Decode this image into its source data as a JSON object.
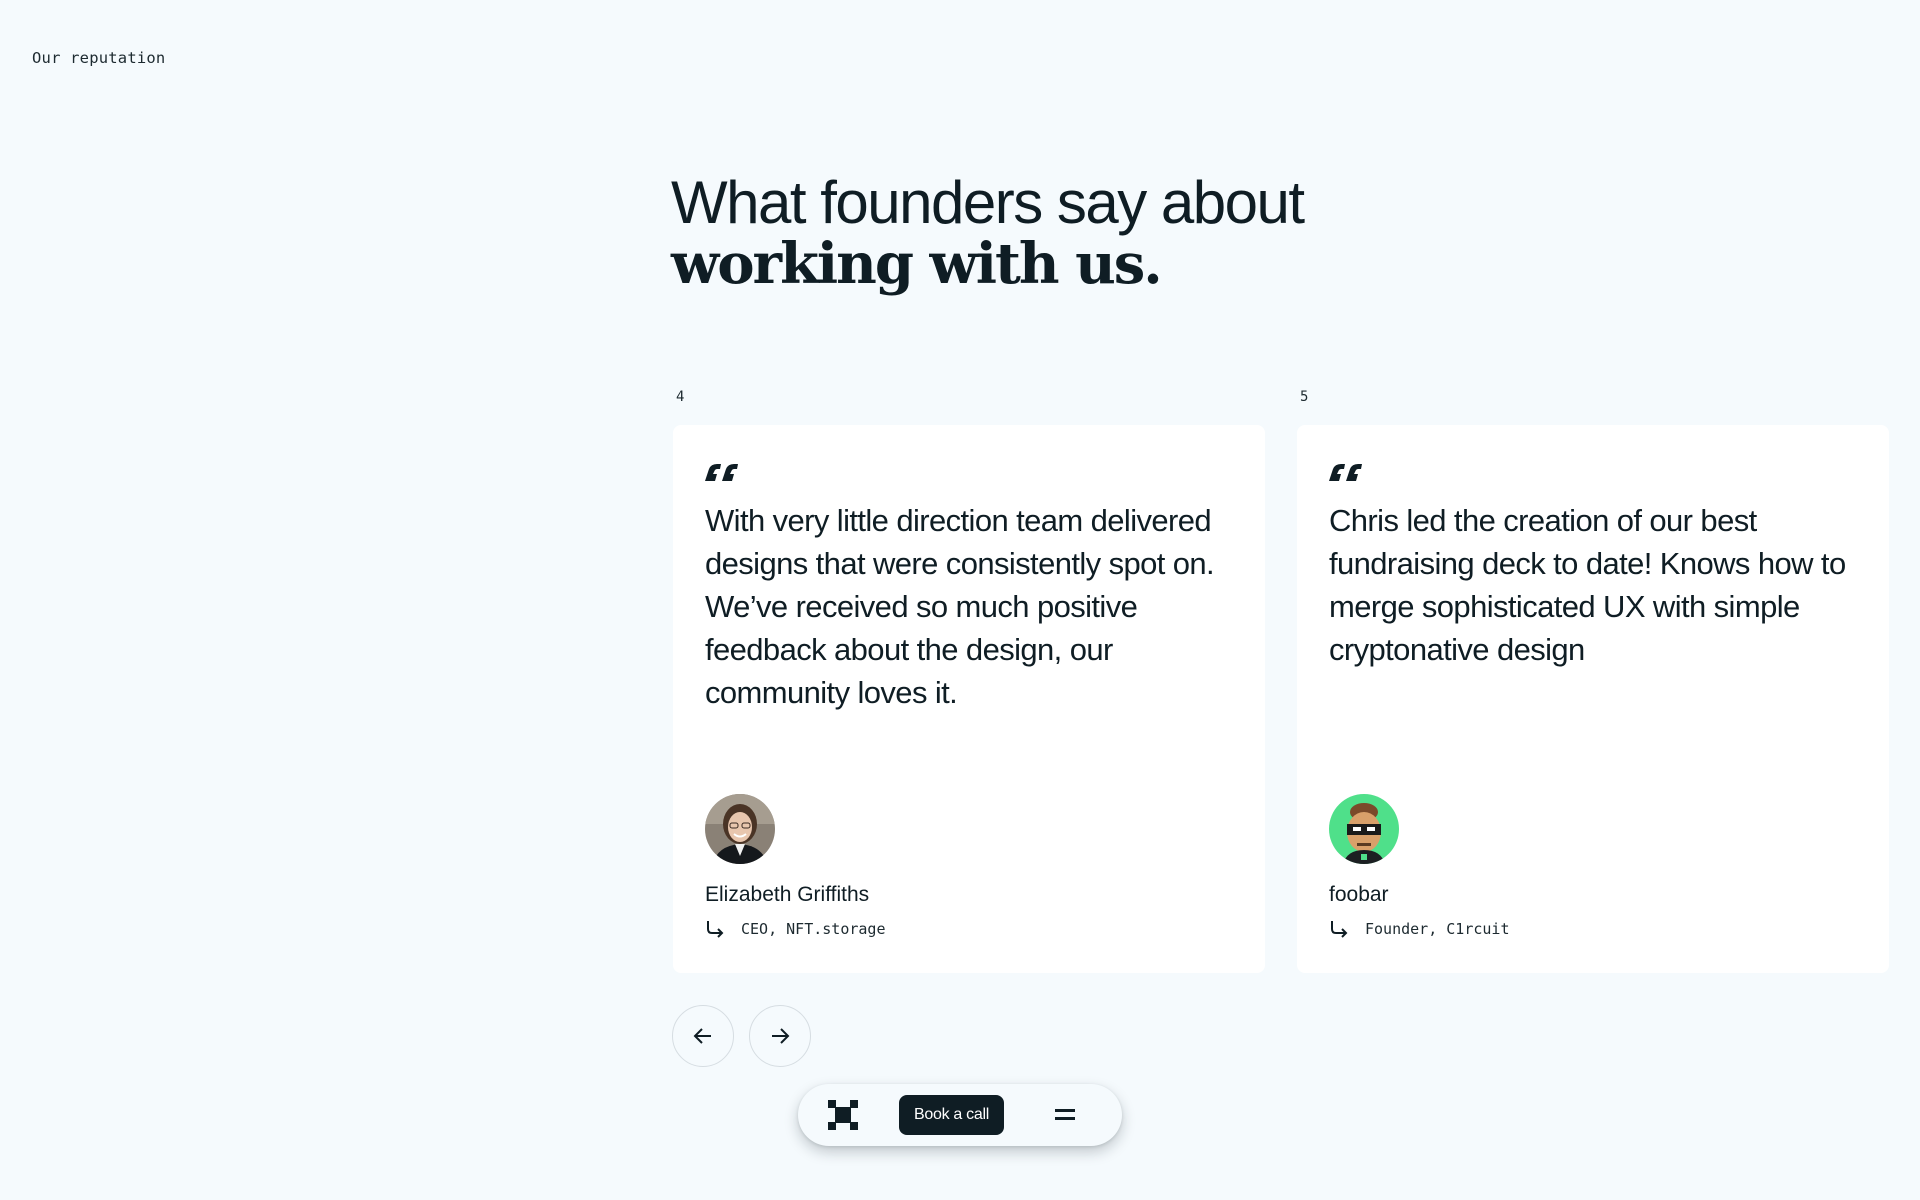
{
  "section_label": "Our reputation",
  "headline": {
    "line1": "What founders say about",
    "line2": "working with us."
  },
  "testimonials": [
    {
      "index": "4",
      "quote": "With very little direction team delivered designs that were consistently spot on. We’ve received so much positive feedback about the design, our community loves it.",
      "author": "Elizabeth Griffiths",
      "role": "CEO, NFT.storage"
    },
    {
      "index": "5",
      "quote": "Chris led the creation of our best fundraising deck to date! Knows how to merge sophisticated UX with simple cryptonative design",
      "author": "foobar",
      "role": "Founder, C1rcuit"
    }
  ],
  "nav": {
    "prev_icon": "arrow-left-icon",
    "next_icon": "arrow-right-icon"
  },
  "bottom_bar": {
    "logo_icon": "brand-logo-icon",
    "cta_label": "Book a call",
    "menu_icon": "menu-icon"
  },
  "colors": {
    "background": "#f5fafd",
    "card": "#ffffff",
    "text": "#0f1d24",
    "button": "#0f1d24",
    "avatar2_bg": "#4fe08a"
  }
}
